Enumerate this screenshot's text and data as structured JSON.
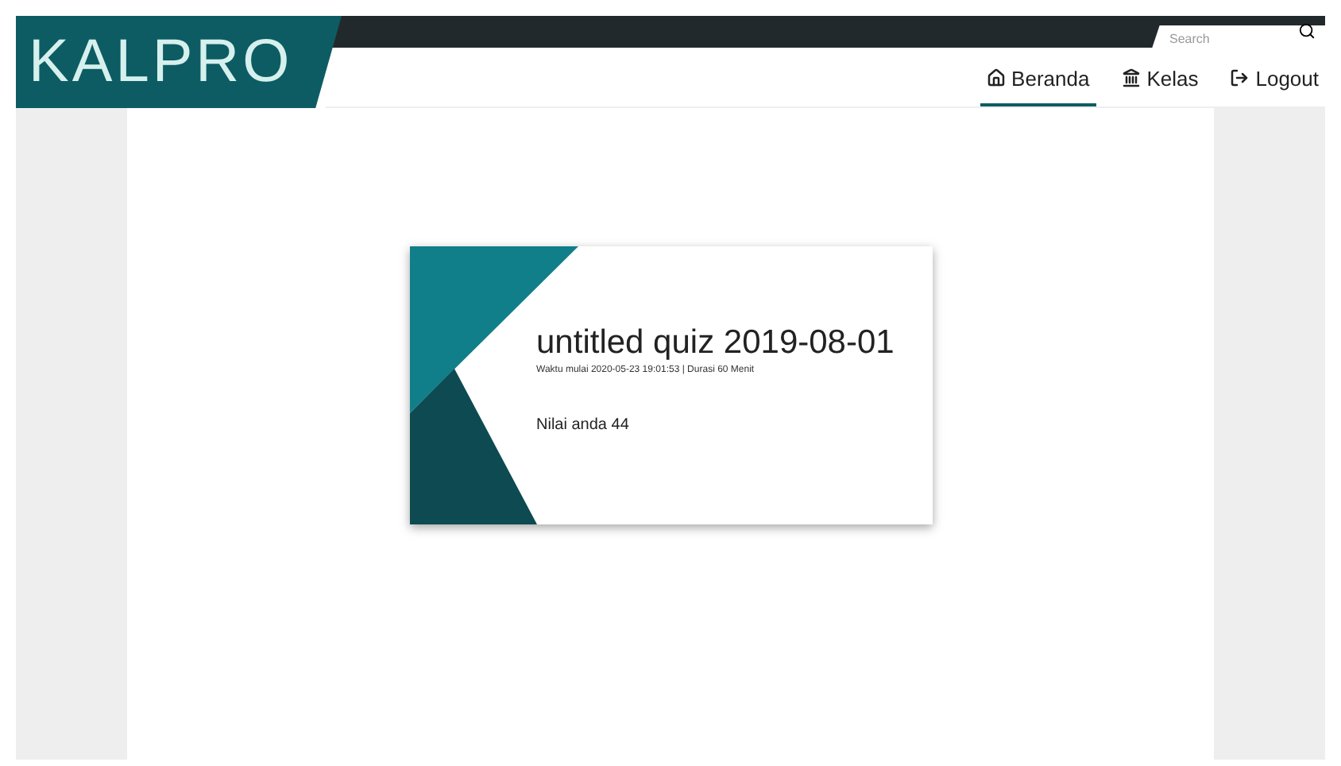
{
  "logo": {
    "text": "KALPRO"
  },
  "search": {
    "placeholder": "Search"
  },
  "nav": [
    {
      "label": "Beranda",
      "selected": true
    },
    {
      "label": "Kelas",
      "selected": false
    },
    {
      "label": "Logout",
      "selected": false
    }
  ],
  "quiz_card": {
    "title": "untitled quiz 2019-08-01",
    "meta": "Waktu mulai 2020-05-23 19:01:53 | Durasi 60 Menit",
    "score": "Nilai anda 44"
  }
}
